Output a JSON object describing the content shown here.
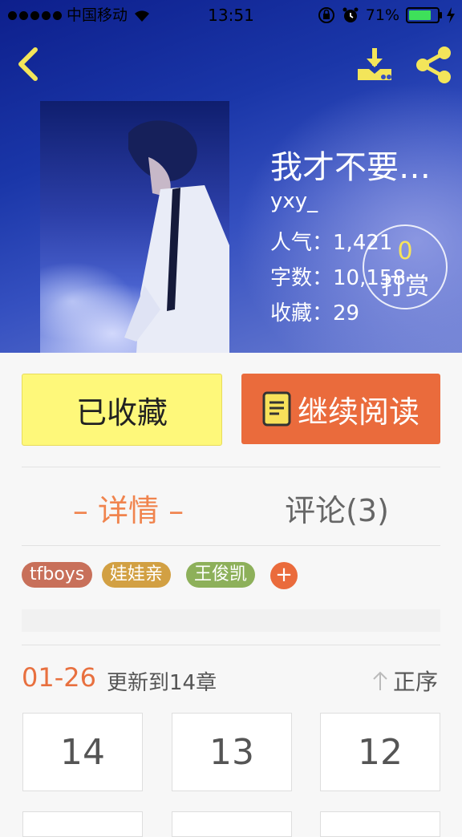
{
  "status_bar": {
    "carrier": "中国移动",
    "time": "13:51",
    "battery": "71%",
    "battery_level": 0.71
  },
  "header": {
    "back_icon": "chevron-left-icon",
    "download_icon": "download-icon",
    "share_icon": "share-icon",
    "icon_color": "#f3e55a"
  },
  "book": {
    "title": "我才不要…",
    "author": "yxy_",
    "stats": [
      {
        "label": "人气：",
        "value": "1,421"
      },
      {
        "label": "字数：",
        "value": "10,158"
      },
      {
        "label": "收藏：",
        "value": "29"
      }
    ],
    "tip": {
      "count": "0",
      "label": "打赏"
    }
  },
  "actions": {
    "collected_label": "已收藏",
    "continue_label": "继续阅读"
  },
  "tabs": [
    {
      "label": "– 详情 –",
      "active": true
    },
    {
      "label": "评论(3)",
      "active": false
    }
  ],
  "tags": [
    {
      "label": "tfboys",
      "color": "#c8705a"
    },
    {
      "label": "娃娃亲",
      "color": "#d2a043"
    },
    {
      "label": "王俊凯",
      "color": "#8db05a"
    }
  ],
  "tag_add_label": "+",
  "update": {
    "date": "01-26",
    "text": "更新到14章",
    "sort_label": "正序"
  },
  "chapters": [
    "14",
    "13",
    "12"
  ],
  "colors": {
    "accent_orange": "#ea6b3c",
    "collected_yellow": "#fef87a"
  }
}
